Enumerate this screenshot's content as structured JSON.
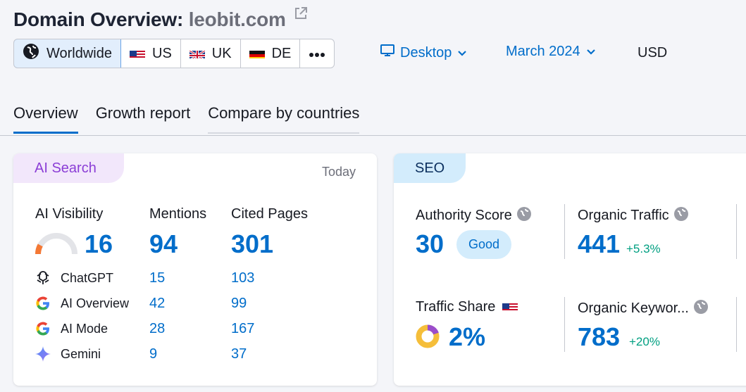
{
  "header": {
    "title_prefix": "Domain Overview:",
    "domain": "leobit.com"
  },
  "region_selector": {
    "options": [
      {
        "label": "Worldwide",
        "icon": "globe-icon",
        "active": true
      },
      {
        "label": "US",
        "icon": "us-flag-icon"
      },
      {
        "label": "UK",
        "icon": "uk-flag-icon"
      },
      {
        "label": "DE",
        "icon": "de-flag-icon"
      }
    ],
    "more_icon": "more-dots-icon"
  },
  "device_dropdown": {
    "label": "Desktop",
    "icon": "desktop-icon"
  },
  "date_dropdown": {
    "label": "March 2024"
  },
  "currency": "USD",
  "tabs": [
    {
      "label": "Overview",
      "active": true
    },
    {
      "label": "Growth report"
    },
    {
      "label": "Compare by countries"
    }
  ],
  "ai_card": {
    "badge": "AI Search",
    "date": "Today",
    "columns": [
      "AI Visibility",
      "Mentions",
      "Cited Pages"
    ],
    "totals": {
      "visibility": "16",
      "visibility_fraction": 0.16,
      "mentions": "94",
      "cited": "301"
    },
    "rows": [
      {
        "name": "ChatGPT",
        "icon": "chatgpt-icon",
        "mentions": "15",
        "cited": "103"
      },
      {
        "name": "AI Overview",
        "icon": "google-icon",
        "mentions": "42",
        "cited": "99"
      },
      {
        "name": "AI Mode",
        "icon": "google-icon",
        "mentions": "28",
        "cited": "167"
      },
      {
        "name": "Gemini",
        "icon": "gemini-icon",
        "mentions": "9",
        "cited": "37"
      }
    ]
  },
  "seo_card": {
    "badge": "SEO",
    "authority": {
      "label": "Authority Score",
      "value": "30",
      "rating": "Good"
    },
    "organic_traffic": {
      "label": "Organic Traffic",
      "value": "441",
      "delta": "+5.3%"
    },
    "traffic_share": {
      "label": "Traffic Share",
      "value": "2%",
      "flag": "us-flag-icon"
    },
    "organic_keywords": {
      "label": "Organic Keywor...",
      "value": "783",
      "delta": "+20%"
    }
  },
  "colors": {
    "accent": "#006dca",
    "ai_badge_bg": "#f2e7fb",
    "ai_badge_text": "#8b3ed6",
    "seo_badge_bg": "#d3ecfc",
    "positive": "#009f81"
  }
}
